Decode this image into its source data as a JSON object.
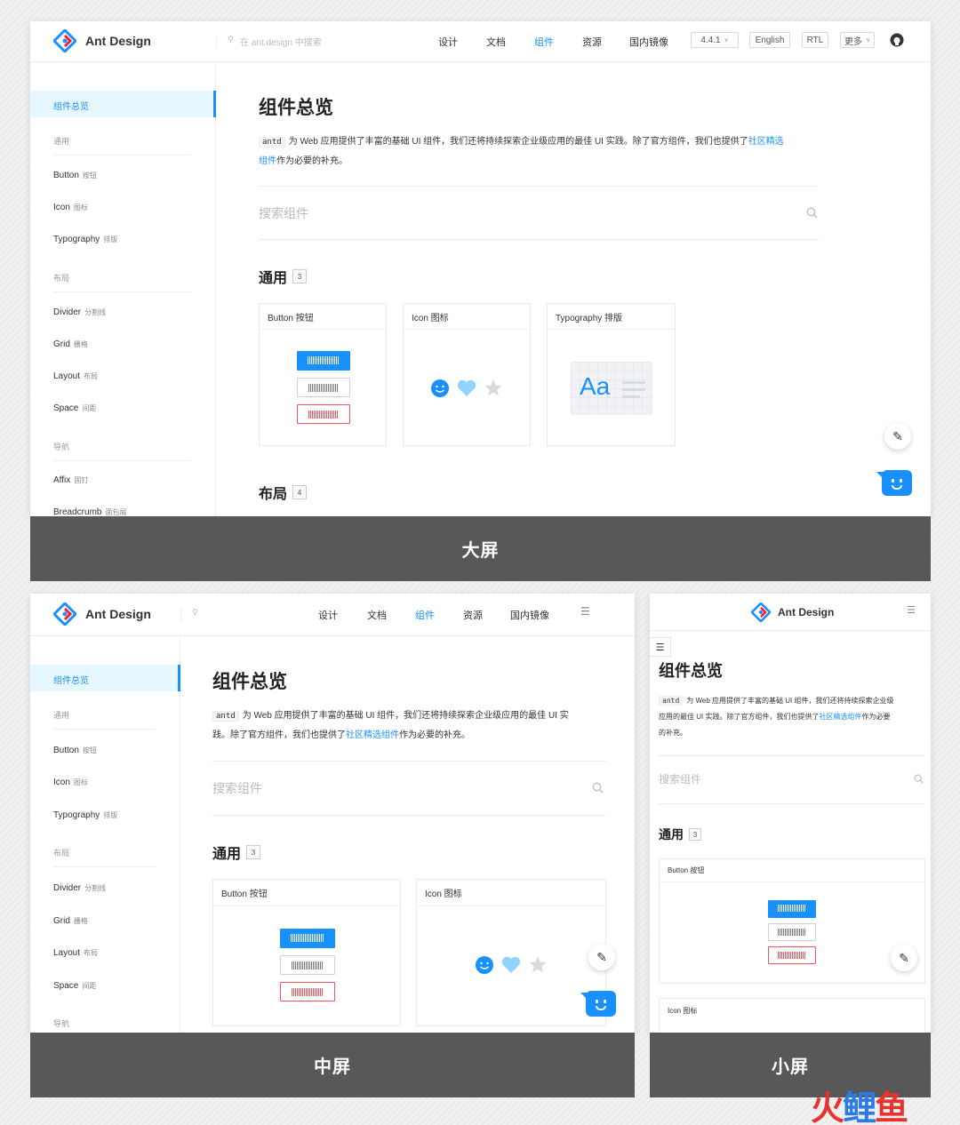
{
  "brand": {
    "name": "Ant Design",
    "color": "#1890ff"
  },
  "nav": [
    "设计",
    "文档",
    "组件",
    "资源",
    "国内镜像"
  ],
  "search_placeholder": "在 ant.design 中搜索",
  "header_buttons": {
    "version": "4.4.1",
    "lang": "English",
    "rtl": "RTL",
    "more": "更多"
  },
  "sidebar": {
    "active": "组件总览",
    "general": "通用",
    "layout": "布局",
    "navigation": "导航",
    "items": {
      "button": {
        "en": "Button",
        "zh": "按钮"
      },
      "icon": {
        "en": "Icon",
        "zh": "图标"
      },
      "typography": {
        "en": "Typography",
        "zh": "排版"
      },
      "divider": {
        "en": "Divider",
        "zh": "分割线"
      },
      "grid": {
        "en": "Grid",
        "zh": "栅格"
      },
      "layout": {
        "en": "Layout",
        "zh": "布局"
      },
      "space": {
        "en": "Space",
        "zh": "间距"
      },
      "affix": {
        "en": "Affix",
        "zh": "固钉"
      },
      "breadcrumb": {
        "en": "Breadcrumb",
        "zh": "面包屑"
      }
    }
  },
  "content": {
    "title": "组件总览",
    "code": "antd",
    "intro_lg_1": "为 Web 应用提供了丰富的基础 UI 组件，我们还将持续探索企业级应用的最佳 UI 实践。除了官方组件，我们也提供了",
    "link_lg_a": "社区精选",
    "link_lg_b": "组件",
    "intro_lg_2": "作为必要的补充。",
    "intro_md_1": "为 Web 应用提供了丰富的基础 UI 组件，我们还将持续探索企业级应用的最佳 UI 实",
    "intro_md_2": "践。除了官方组件，我们也提供了",
    "intro_sm_1": "为 Web 应用提供了丰富的基础 UI 组件，我们还将持续探索企业级",
    "intro_sm_2": "应用的最佳 UI 实践。除了官方组件，我们也提供了",
    "intro_sm_3": "作为必要",
    "intro_sm_4": "的补充。",
    "link_full": "社区精选组件",
    "search": "搜索组件",
    "section_general": "通用",
    "count_general": "3",
    "section_layout": "布局",
    "count_layout": "4",
    "cards": {
      "button": "Button 按钮",
      "icon": "Icon 图标",
      "typography": "Typography 排版"
    },
    "typo_sample": "Aa"
  },
  "captions": {
    "large": "大屏",
    "medium": "中屏",
    "small": "小屏"
  },
  "watermark": {
    "a": "火",
    "b": "鲤",
    "c": "鱼"
  },
  "colors": {
    "primary": "#1890ff",
    "danger": "#f5555a",
    "caption_bg": "#585858"
  }
}
